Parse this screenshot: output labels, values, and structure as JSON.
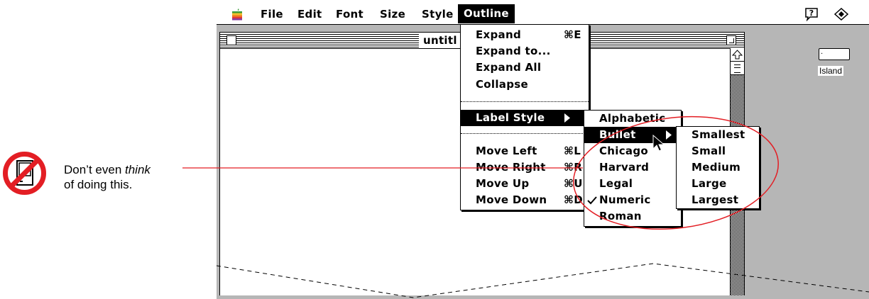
{
  "menubar": {
    "apple_icon": "apple-icon",
    "items": [
      "File",
      "Edit",
      "Font",
      "Size",
      "Style",
      "Outline"
    ],
    "active": "Outline",
    "help_icon": "help-balloon-icon",
    "app_icon": "application-icon"
  },
  "window": {
    "title": "untitl"
  },
  "outline_menu": {
    "items": [
      {
        "label": "Expand",
        "shortcut": "⌘E"
      },
      {
        "label": "Expand to...",
        "shortcut": ""
      },
      {
        "label": "Expand All",
        "shortcut": ""
      },
      {
        "label": "Collapse",
        "shortcut": ""
      },
      {
        "label": "Label Style",
        "shortcut": "",
        "submenu": true,
        "highlighted": true
      },
      {
        "label": "Move Left",
        "shortcut": "⌘L"
      },
      {
        "label": "Move Right",
        "shortcut": "⌘R"
      },
      {
        "label": "Move Up",
        "shortcut": "⌘U"
      },
      {
        "label": "Move Down",
        "shortcut": "⌘D"
      }
    ]
  },
  "label_style_menu": {
    "items": [
      {
        "label": "Alphabetic"
      },
      {
        "label": "Bullet",
        "submenu": true,
        "highlighted": true
      },
      {
        "label": "Chicago"
      },
      {
        "label": "Harvard"
      },
      {
        "label": "Legal"
      },
      {
        "label": "Numeric",
        "checked": true
      },
      {
        "label": "Roman"
      }
    ]
  },
  "bullet_menu": {
    "items": [
      "Smallest",
      "Small",
      "Medium",
      "Large",
      "Largest"
    ]
  },
  "desktop": {
    "icon_label": "Island"
  },
  "annotation": {
    "text_before": "Don’t even ",
    "text_emphasis": "think",
    "text_after": "of doing this.",
    "icon": "no-hierarchical-menus-icon",
    "accent_color": "#e31e24"
  }
}
